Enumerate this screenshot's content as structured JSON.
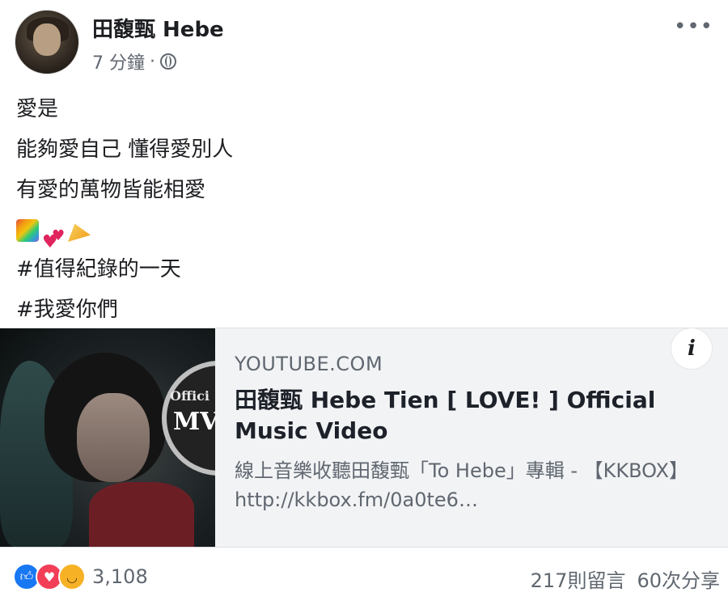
{
  "post": {
    "author": "田馥甄 Hebe",
    "time": "7 分鐘",
    "separator": "·",
    "more_label": "•••",
    "lines": [
      "愛是",
      "能夠愛自己 懂得愛別人",
      "有愛的萬物皆能相愛"
    ],
    "emojis": [
      "rainbow-icon",
      "two-hearts-icon",
      "party-popper-icon"
    ],
    "hashtags": [
      "#值得紀錄的一天",
      "#我愛你們"
    ]
  },
  "link": {
    "domain": "YOUTUBE.COM",
    "title": "田馥甄 Hebe Tien [ LOVE! ] Official Music Video",
    "description": "線上音樂收聽田馥甄「To Hebe」專輯 - 【KKBOX】http://kkbox.fm/0a0te6…",
    "info_label": "i",
    "thumbnail_text_1": "Offici",
    "thumbnail_text_2": "MV"
  },
  "footer": {
    "reaction_count": "3,108",
    "comments": "217則留言",
    "shares": "60次分享"
  },
  "colors": {
    "like": "#1877f2",
    "love": "#f33e58",
    "haha": "#f7b125",
    "meta_text": "#606770"
  }
}
